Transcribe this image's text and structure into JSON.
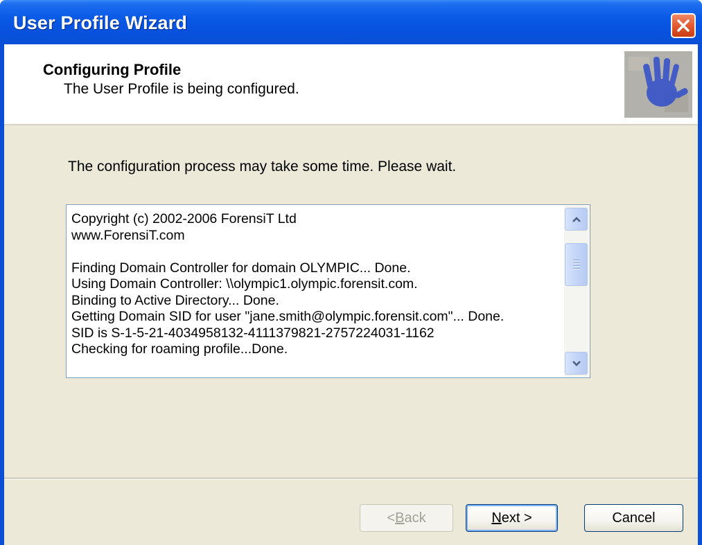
{
  "window": {
    "title": "User Profile Wizard"
  },
  "header": {
    "title": "Configuring Profile",
    "subtitle": "The User Profile is being configured."
  },
  "main": {
    "intro": "The configuration process may take some time. Please wait.",
    "log_lines": [
      "Copyright (c) 2002-2006 ForensiT Ltd",
      "www.ForensiT.com",
      "",
      "Finding Domain Controller for domain OLYMPIC... Done.",
      "Using Domain Controller: \\\\olympic1.olympic.forensit.com.",
      "Binding to Active Directory... Done.",
      "Getting Domain SID for user \"jane.smith@olympic.forensit.com\"... Done.",
      "SID is S-1-5-21-4034958132-4111379821-2757224031-1162",
      "Checking for roaming profile...Done."
    ]
  },
  "buttons": {
    "back_prefix": "< ",
    "back_key": "B",
    "back_rest": "ack",
    "next_key": "N",
    "next_rest": "ext >",
    "cancel": "Cancel"
  },
  "colors": {
    "titlebar": "#0a5ae6",
    "dialog_bg": "#ece9d8",
    "close_button": "#e45a30"
  },
  "icons": {
    "close": "close-icon",
    "logo": "handprint-logo",
    "scroll_up": "chevron-up-icon",
    "scroll_down": "chevron-down-icon"
  }
}
